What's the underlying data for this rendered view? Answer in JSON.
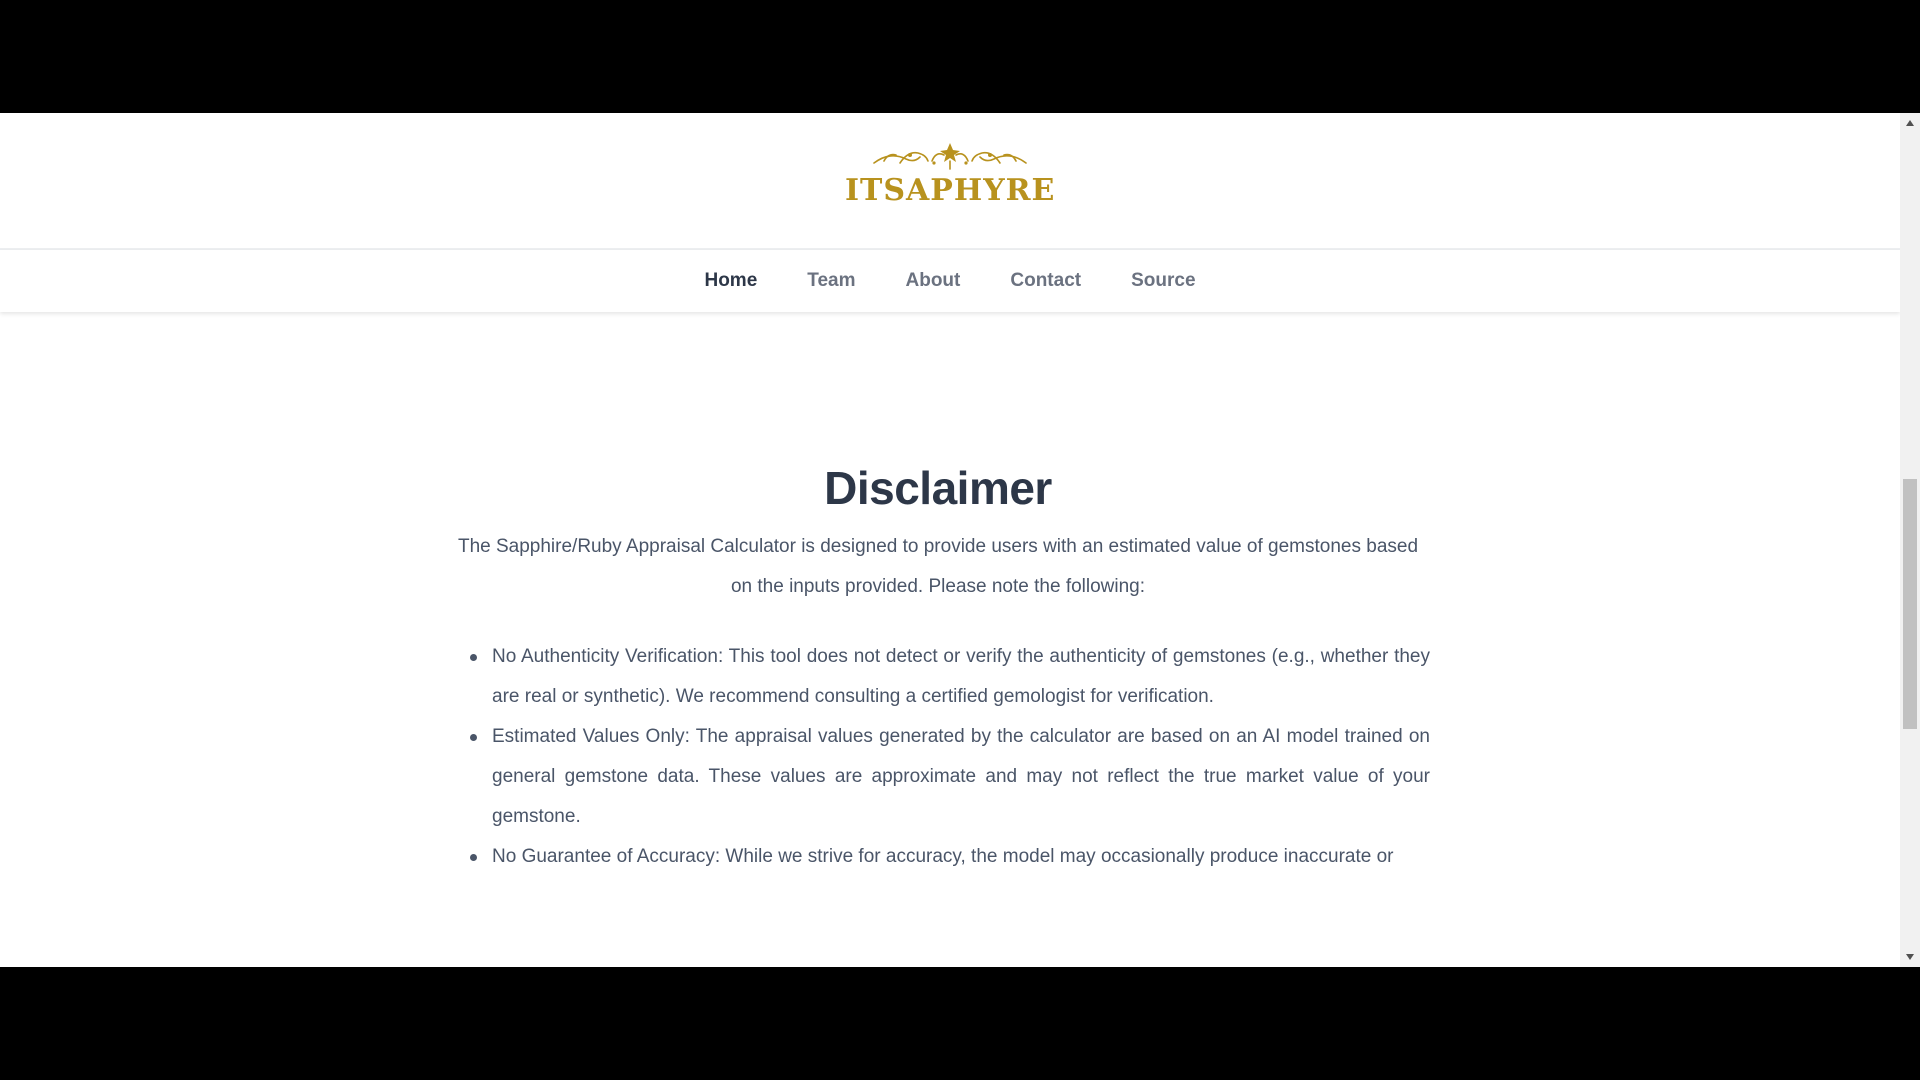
{
  "brand": {
    "name": "ITSAPHYRE",
    "color": "#b8921e"
  },
  "nav": {
    "items": [
      {
        "label": "Home",
        "active": true
      },
      {
        "label": "Team",
        "active": false
      },
      {
        "label": "About",
        "active": false
      },
      {
        "label": "Contact",
        "active": false
      },
      {
        "label": "Source",
        "active": false
      }
    ]
  },
  "disclaimer": {
    "title": "Disclaimer",
    "intro": "The Sapphire/Ruby Appraisal Calculator is designed to provide users with an estimated value of gemstones based on the inputs provided. Please note the following:",
    "items": [
      "No Authenticity Verification: This tool does not detect or verify the authenticity of gemstones (e.g., whether they are real or synthetic). We recommend consulting a certified gemologist for verification.",
      "Estimated Values Only: The appraisal values generated by the calculator are based on an AI model trained on general gemstone data. These values are approximate and may not reflect the true market value of your gemstone.",
      "No Guarantee of Accuracy: While we strive for accuracy, the model may occasionally produce inaccurate or"
    ]
  },
  "colors": {
    "heading": "#2d3748",
    "body_text": "#4a5568",
    "nav_inactive": "#6b7280"
  },
  "icons": {
    "logo_ornament": "filigree-crown-ornament-icon",
    "scroll_up": "triangle-up-icon",
    "scroll_down": "triangle-down-icon"
  }
}
